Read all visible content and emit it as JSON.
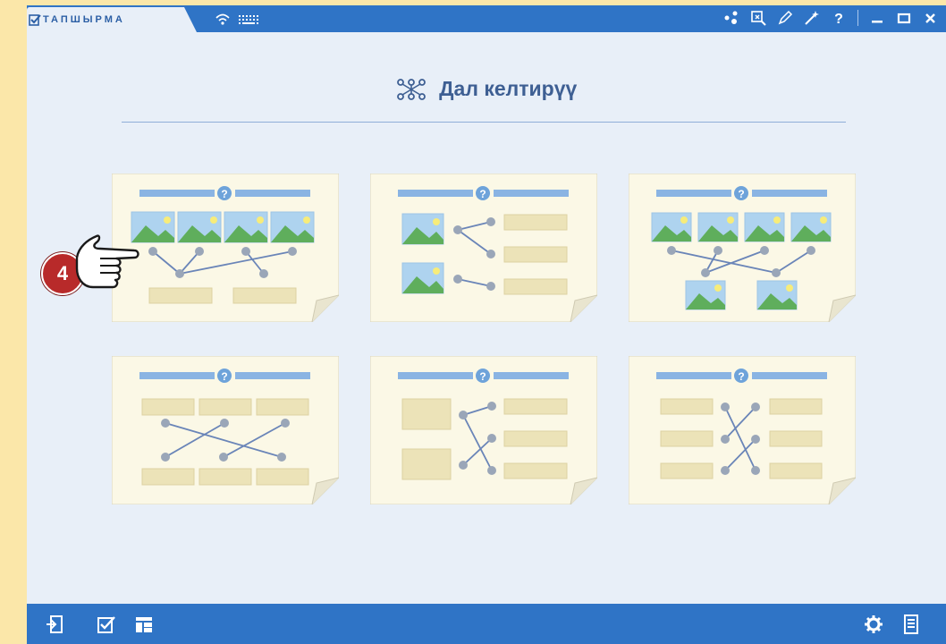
{
  "window": {
    "title": "ТАПШЫРМА"
  },
  "header": {
    "title": "Дал келтирүү"
  },
  "templates": [
    {
      "name": "image-to-text-4x2"
    },
    {
      "name": "image-to-text-2x3"
    },
    {
      "name": "image-to-image-4x2"
    },
    {
      "name": "text-to-text-3x3"
    },
    {
      "name": "block-to-text-2x3"
    },
    {
      "name": "text-to-text-cross"
    }
  ],
  "annotation": {
    "step_number": "4"
  },
  "colors": {
    "accent": "#2f74c6",
    "background": "#e8eff8",
    "outer": "#fbe7a9",
    "card": "#fbf8e6",
    "badge": "#b82a2a"
  },
  "icons": {
    "titlebar": [
      "wifi-icon",
      "keyboard-icon",
      "share-icon",
      "crop-icon",
      "pen-icon",
      "magic-wand-icon",
      "help-icon",
      "minimize-icon",
      "maximize-icon",
      "close-icon"
    ],
    "bottombar": [
      "exit-icon",
      "task-check-icon",
      "layout-icon",
      "settings-icon",
      "list-icon"
    ]
  }
}
